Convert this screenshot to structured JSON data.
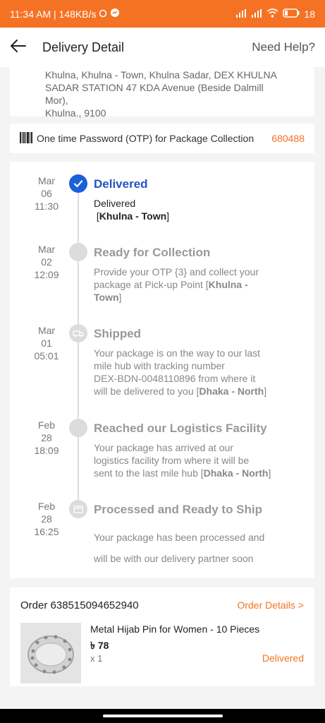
{
  "status_bar": {
    "time_speed": "11:34 AM | 148KB/s",
    "battery": "18"
  },
  "app_bar": {
    "title": "Delivery Detail",
    "help": "Need Help?"
  },
  "address": {
    "line1": "Khulna, Khulna - Town, Khulna Sadar, DEX KHULNA",
    "line2": "SADAR STATION 47 KDA Avenue (Beside Dalmill Mor),",
    "line3": "Khulna., 9100"
  },
  "otp": {
    "label": "One time Password (OTP) for Package Collection",
    "code": "680488"
  },
  "timeline": [
    {
      "month": "Mar",
      "day": "06",
      "time": "11:30",
      "title": "Delivered",
      "desc_line1": "Delivered",
      "location": "Khulna - Town"
    },
    {
      "month": "Mar",
      "day": "02",
      "time": "12:09",
      "title": "Ready for Collection",
      "desc_line1": "Provide your OTP {3} and collect your",
      "desc_line2": "package at Pick-up Point [",
      "location_a": "Khulna -",
      "location_b": "Town"
    },
    {
      "month": "Mar",
      "day": "01",
      "time": "05:01",
      "title": "Shipped",
      "desc_line1": "Your package is on the way to our last",
      "desc_line2": "mile hub with tracking number",
      "desc_line3": "DEX-BDN-0048110896 from where it",
      "desc_line4": "will be delivered to you [",
      "location": "Dhaka - North"
    },
    {
      "month": "Feb",
      "day": "28",
      "time": "18:09",
      "title": "Reached our Logistics Facility",
      "desc_line1": "Your package has arrived at our",
      "desc_line2": "logistics facility from where it will be",
      "desc_line3": "sent to the last mile hub [",
      "location": "Dhaka - North"
    },
    {
      "month": "Feb",
      "day": "28",
      "time": "16:25",
      "title": "Processed and Ready to Ship",
      "desc_line1": "Your package has been processed and",
      "desc_line2": "will be with our delivery partner soon"
    }
  ],
  "order": {
    "id": "Order 638515094652940",
    "details_link": "Order Details >",
    "product_name": "Metal Hijab Pin for Women - 10 Pieces",
    "price": "৳ 78",
    "quantity": "x 1",
    "status": "Delivered"
  },
  "colors": {
    "accent": "#f57224",
    "active_blue": "#1a60d8"
  }
}
